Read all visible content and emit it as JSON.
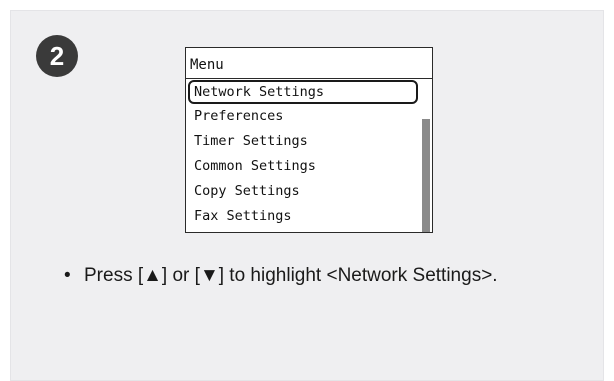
{
  "step": {
    "number": "2"
  },
  "lcd": {
    "title": "Menu",
    "items": [
      {
        "label": "Network Settings",
        "selected": true
      },
      {
        "label": "Preferences"
      },
      {
        "label": "Timer Settings"
      },
      {
        "label": "Common Settings"
      },
      {
        "label": "Copy Settings"
      },
      {
        "label": "Fax Settings"
      }
    ]
  },
  "instruction": {
    "bullet": "•",
    "text": "Press [▲] or [▼] to highlight <Network Settings>."
  },
  "colors": {
    "panel_background": "#efeff1",
    "badge_background": "#3a3a3a",
    "scroll_thumb": "#8a8a8a"
  }
}
